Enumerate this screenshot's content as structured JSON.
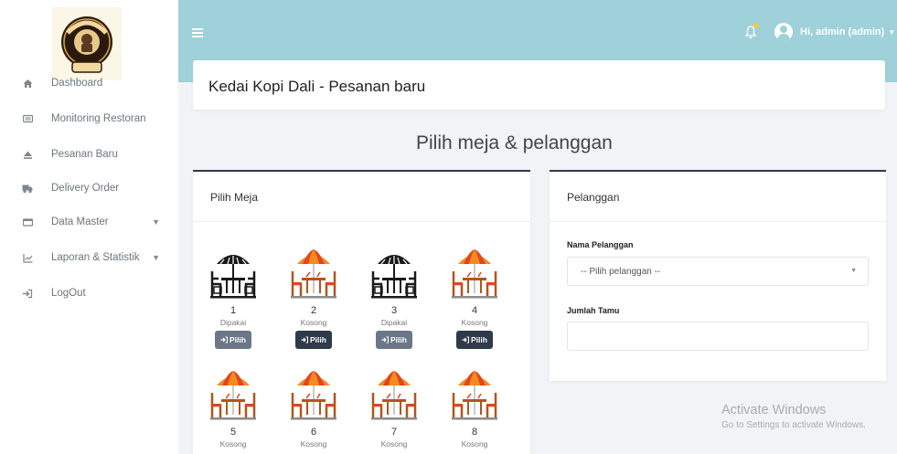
{
  "logo": {
    "text_top": "KEDAI KOPI",
    "text_bottom": "DALI"
  },
  "sidebar": {
    "items": [
      {
        "label": "Dashboard",
        "icon": "home-icon"
      },
      {
        "label": "Monitoring Restoran",
        "icon": "monitor-icon"
      },
      {
        "label": "Pesanan Baru",
        "icon": "eject-icon"
      },
      {
        "label": "Delivery Order",
        "icon": "truck-icon"
      },
      {
        "label": "Data Master",
        "icon": "database-icon",
        "has_caret": true
      },
      {
        "label": "Laporan & Statistik",
        "icon": "chart-icon",
        "has_caret": true
      },
      {
        "label": "LogOut",
        "icon": "logout-icon"
      }
    ]
  },
  "topbar": {
    "user_label": "Hi, admin (admin)",
    "bg_color": "#9ed1d9"
  },
  "page": {
    "title": "Kedai Kopi Dali - Pesanan baru",
    "section_heading": "Pilih meja & pelanggan"
  },
  "pilih_meja": {
    "title": "Pilih Meja",
    "button_label": "Pilih",
    "tables": [
      {
        "number": "1",
        "status": "Dipakai",
        "icon": "occupied-table-icon"
      },
      {
        "number": "2",
        "status": "Kosong",
        "icon": "empty-table-icon"
      },
      {
        "number": "3",
        "status": "Dipakai",
        "icon": "occupied-table-icon"
      },
      {
        "number": "4",
        "status": "Kosong",
        "icon": "empty-table-icon"
      },
      {
        "number": "5",
        "status": "Kosong",
        "icon": "empty-table-icon"
      },
      {
        "number": "6",
        "status": "Kosong",
        "icon": "empty-table-icon"
      },
      {
        "number": "7",
        "status": "Kosong",
        "icon": "empty-table-icon"
      },
      {
        "number": "8",
        "status": "Kosong",
        "icon": "empty-table-icon"
      }
    ]
  },
  "pelanggan": {
    "title": "Pelanggan",
    "nama_label": "Nama Pelanggan",
    "nama_select_value": "-- Pilih pelanggan --",
    "jumlah_label": "Jumlah Tamu",
    "jumlah_value": ""
  },
  "watermark": {
    "title": "Activate Windows",
    "subtitle": "Go to Settings to activate Windows."
  }
}
